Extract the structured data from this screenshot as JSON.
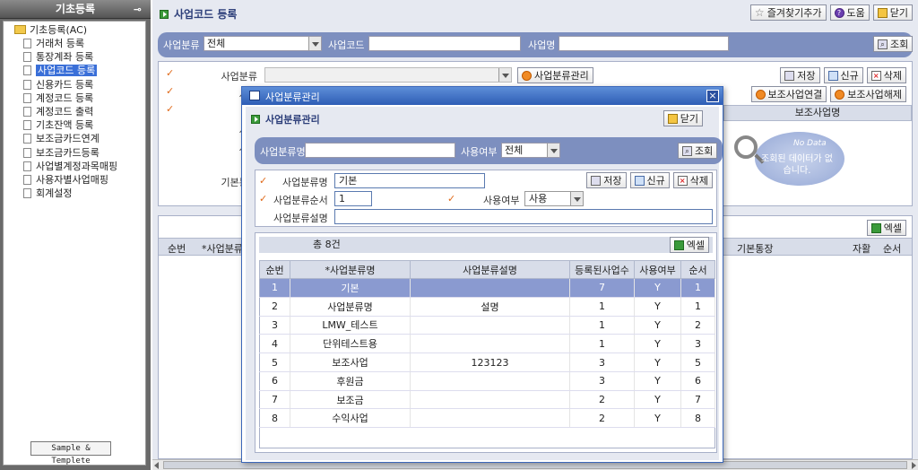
{
  "sidebar": {
    "title": "기초등록",
    "pin_icon": "pin-icon",
    "root": "기초등록(AC)",
    "items": [
      "거래처 등록",
      "통장계좌 등록",
      "사업코드 등록",
      "신용카드 등록",
      "계정코드 등록",
      "계정코드 출력",
      "기초잔액 등록",
      "보조금카드연계",
      "보조금카드등록",
      "사업별계정과목매핑",
      "사용자별사업매핑",
      "회계설정"
    ],
    "selected_index": 2,
    "sample_button": "Sample & Templete"
  },
  "page": {
    "title": "사업코드 등록",
    "buttons": {
      "favorite": "즐겨찾기추가",
      "help": "도움",
      "close": "닫기"
    }
  },
  "search": {
    "category_label": "사업분류",
    "category_value": "전체",
    "code_label": "사업코드",
    "name_label": "사업명",
    "search_button": "조회"
  },
  "detail": {
    "labels": [
      "사업분류",
      "사업",
      "사",
      "사업",
      "사업",
      "",
      "기본통장"
    ],
    "category_manage_button": "사업분류관리",
    "save": "저장",
    "new": "신규",
    "delete": "삭제",
    "sub_link": "보조사업연결",
    "sub_unlink": "보조사업해제",
    "sub_header": "보조사업명",
    "nodata_en": "No Data",
    "nodata_ko": "조회된 데이터가 없습니다."
  },
  "list": {
    "excel": "엑셀",
    "headers": [
      "순번",
      "*사업분류",
      "기본통장",
      "자활",
      "순서"
    ]
  },
  "dialog": {
    "window_title": "사업분류관리",
    "title": "사업분류관리",
    "close": "닫기",
    "search": {
      "name_label": "사업분류명",
      "use_label": "사용여부",
      "use_value": "전체",
      "button": "조회"
    },
    "form": {
      "name_label": "사업분류명",
      "name_value": "기본",
      "order_label": "사업분류순서",
      "order_value": "1",
      "use_label": "사용여부",
      "use_value": "사용",
      "desc_label": "사업분류설명",
      "desc_value": "",
      "save": "저장",
      "new": "신규",
      "delete": "삭제"
    },
    "total": "총 8건",
    "excel": "엑셀",
    "columns": [
      "순번",
      "*사업분류명",
      "사업분류설명",
      "등록된사업수",
      "사용여부",
      "순서"
    ],
    "rows": [
      [
        "1",
        "기본",
        "",
        "7",
        "Y",
        "1"
      ],
      [
        "2",
        "사업분류명",
        "설명",
        "1",
        "Y",
        "1"
      ],
      [
        "3",
        "LMW_테스트",
        "",
        "1",
        "Y",
        "2"
      ],
      [
        "4",
        "단위테스트용",
        "",
        "1",
        "Y",
        "3"
      ],
      [
        "5",
        "보조사업",
        "123123",
        "3",
        "Y",
        "5"
      ],
      [
        "6",
        "후원금",
        "",
        "3",
        "Y",
        "6"
      ],
      [
        "7",
        "보조금",
        "",
        "2",
        "Y",
        "7"
      ],
      [
        "8",
        "수익사업",
        "",
        "2",
        "Y",
        "8"
      ]
    ],
    "selected_row": 0
  }
}
